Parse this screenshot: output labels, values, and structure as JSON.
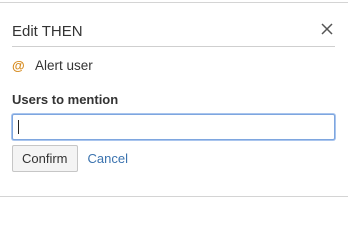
{
  "dialog": {
    "title": "Edit THEN",
    "close_icon": "close-icon",
    "action": {
      "icon": "at-sign-icon",
      "icon_glyph": "@",
      "label": "Alert user"
    },
    "field": {
      "label": "Users to mention",
      "value": "",
      "placeholder": ""
    },
    "buttons": {
      "confirm": "Confirm",
      "cancel": "Cancel"
    },
    "colors": {
      "accent_link": "#3b73af",
      "at_icon": "#d68a1d",
      "input_focus_border": "#7ea6df"
    }
  }
}
